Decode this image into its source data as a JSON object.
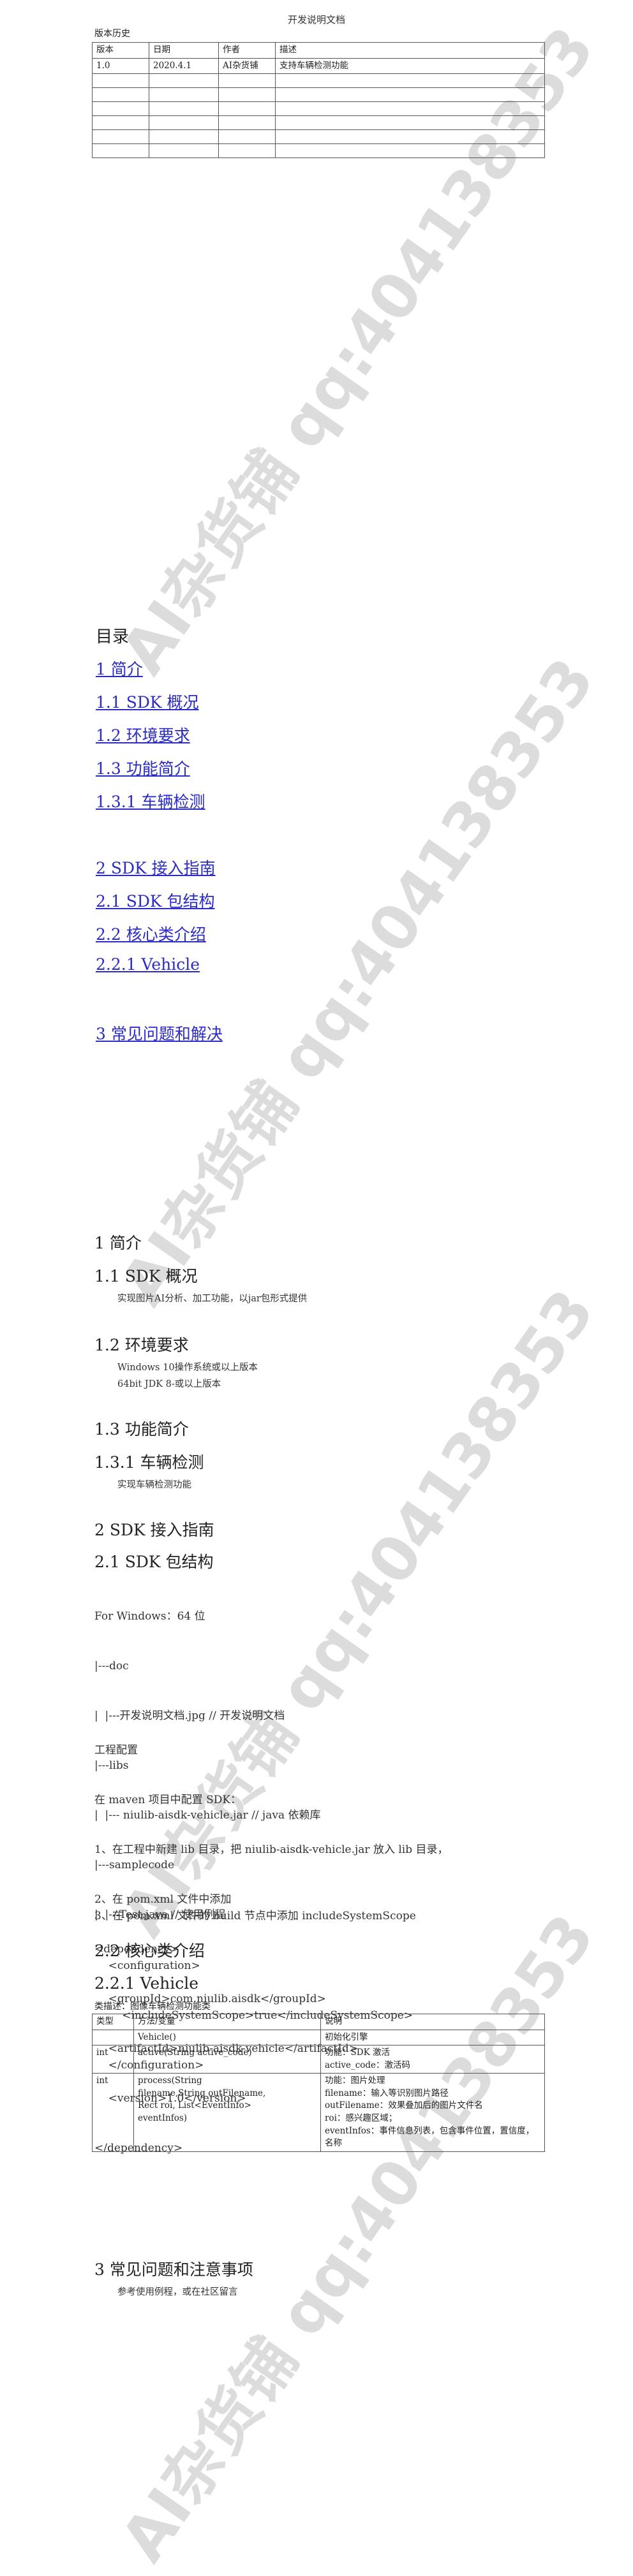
{
  "header": {
    "title": "开发说明文档"
  },
  "history": {
    "caption": "版本历史",
    "columns": [
      "版本",
      "日期",
      "作者",
      "描述"
    ],
    "rows": [
      [
        "1.0",
        "2020.4.1",
        "AI杂货铺",
        "支持车辆检测功能"
      ],
      [
        "",
        "",
        "",
        ""
      ],
      [
        "",
        "",
        "",
        ""
      ],
      [
        "",
        "",
        "",
        ""
      ],
      [
        "",
        "",
        "",
        ""
      ],
      [
        "",
        "",
        "",
        ""
      ],
      [
        "",
        "",
        "",
        ""
      ]
    ]
  },
  "watermark": {
    "text": "AI杂货铺 qq:404138353"
  },
  "toc": {
    "title": "目录",
    "items": [
      "1 简介",
      "1.1 SDK 概况",
      "1.2 环境要求",
      "1.3 功能简介",
      "1.3.1 车辆检测",
      "2 SDK 接入指南",
      "2.1 SDK 包结构",
      "2.2 核心类介绍",
      "2.2.1 Vehicle",
      "3 常见问题和解决"
    ]
  },
  "content": {
    "s1": "1 简介",
    "s11": "1.1 SDK 概况",
    "s11_text": "实现图片AI分析、加工功能，以jar包形式提供",
    "s12": "1.2 环境要求",
    "s12_line1": "Windows 10操作系统或以上版本",
    "s12_line2": "64bit JDK 8-或以上版本",
    "s13": "1.3 功能简介",
    "s131": "1.3.1 车辆检测",
    "s131_text": "实现车辆检测功能",
    "s2": "2 SDK 接入指南",
    "s21": "2.1 SDK 包结构",
    "tree": [
      "For Windows：64 位",
      "|---doc",
      "|  |---开发说明文档.jpg // 开发说明文档",
      "|---libs",
      "|  |--- niulib-aisdk-vehicle.jar // java 依赖库",
      "|---samplecode",
      "|  |---Test.java // 使用例程"
    ],
    "config": [
      "工程配置",
      "在 maven 项目中配置 SDK：",
      "1、在工程中新建 lib 目录，把 niulib-aisdk-vehicle.jar 放入 lib 目录，",
      "2、在 pom.xml 文件中添加",
      "<dependency>",
      "    <groupId>com.niulib.aisdk</groupId>",
      "    <artifactId>niulib-aisdk-vehicle</artifactId>",
      "    <version>1.0</version>",
      "</dependency>"
    ],
    "config2": [
      "3、在 pom.xml 文件的 build 节点中添加 includeSystemScope",
      "    <configuration>",
      "        <includeSystemScope>true</includeSystemScope>",
      "    </configuration>"
    ],
    "s22": "2.2 核心类介绍",
    "s221": "2.2.1 Vehicle",
    "s221_desc": "类描述：图像车辆检测功能类",
    "api_columns": [
      "类型",
      "方法/变量",
      "说明"
    ],
    "api_rows": [
      [
        "",
        "Vehicle()",
        "初始化引擎"
      ],
      [
        "int",
        "active(String active_code)",
        "功能：SDK 激活\nactive_code：激活码"
      ],
      [
        "int",
        "process(String\nfilename,String outFilename,\nRect roi, List<EventInfo>\neventInfos)",
        "功能：图片处理\nfilename：输入等识别图片路径\noutFilename：效果叠加后的图片文件名\nroi：感兴趣区域；\neventInfos：事件信息列表，包含事件位置，置信度，名称"
      ]
    ],
    "s3": "3 常见问题和注意事项",
    "s3_text": "参考使用例程，或在社区留言"
  }
}
